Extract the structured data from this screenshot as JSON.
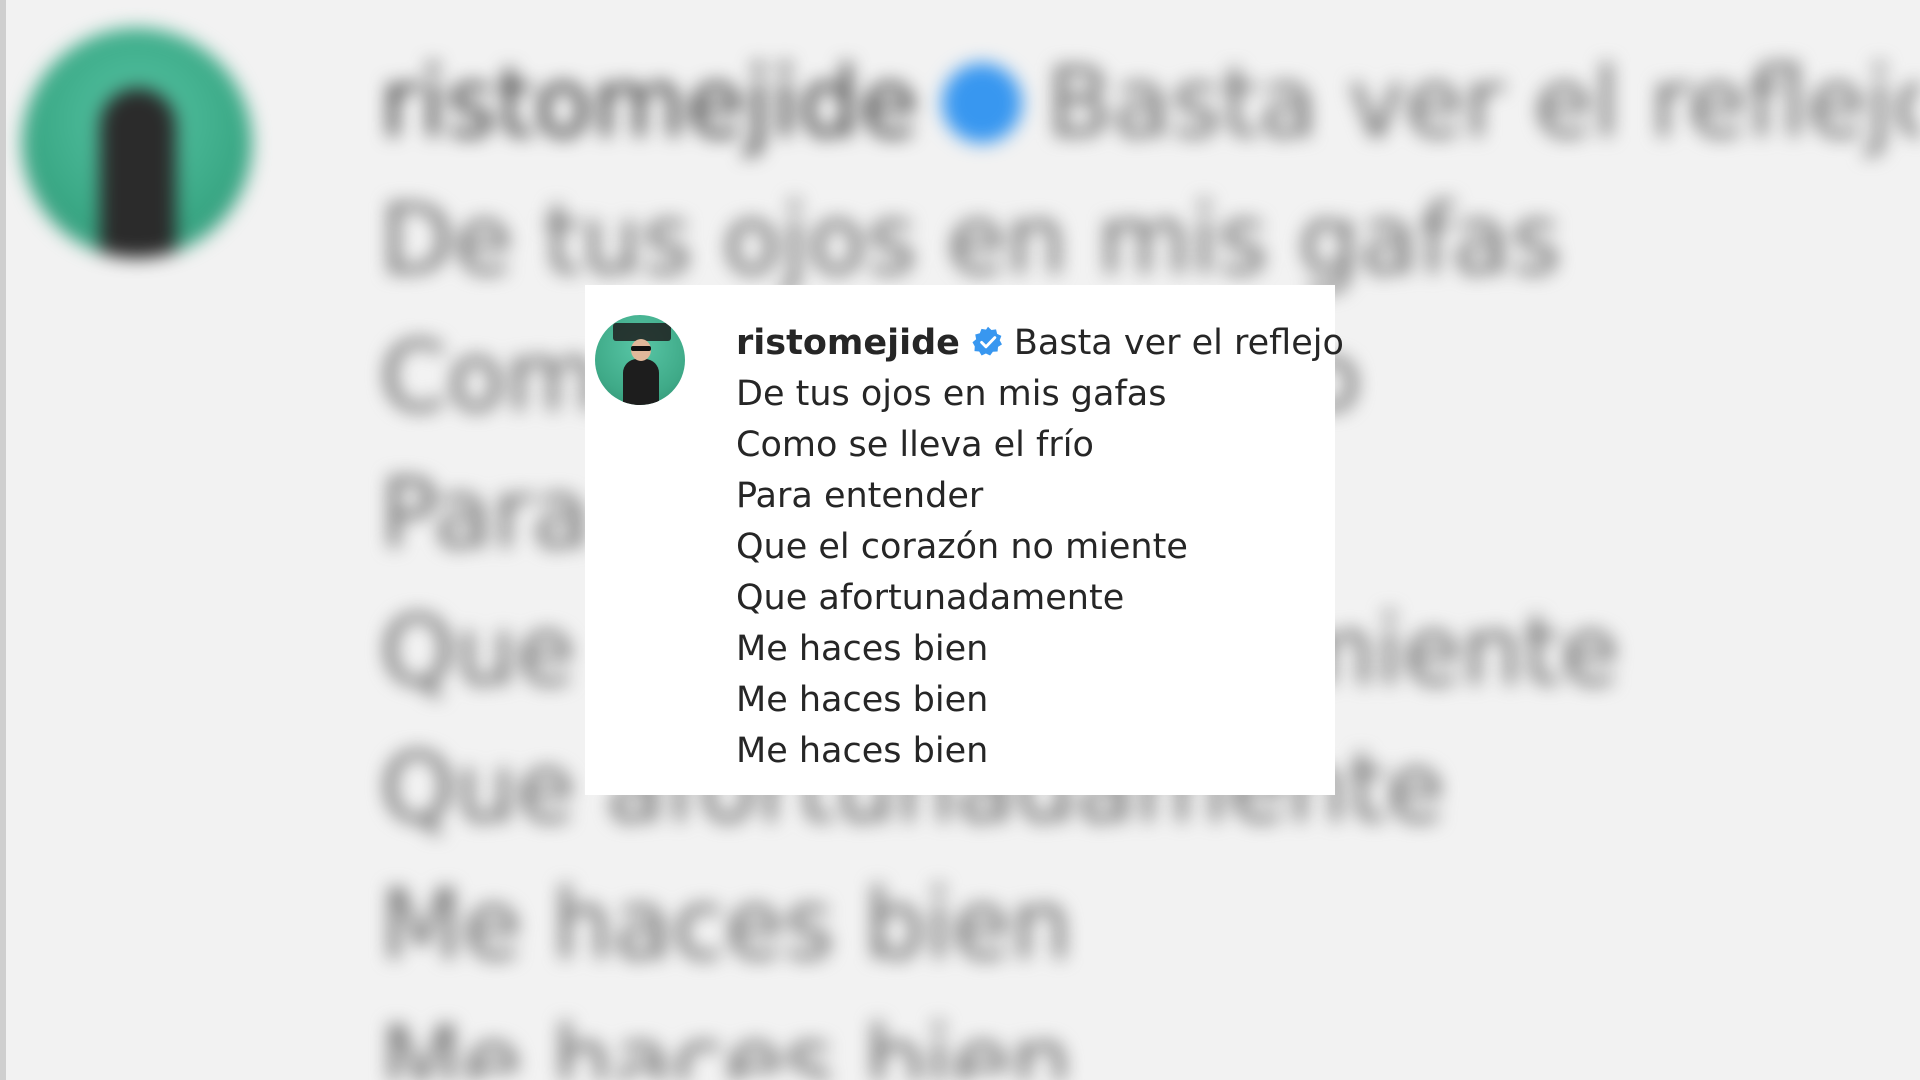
{
  "comment": {
    "username": "ristomejide",
    "verified": true,
    "lines": [
      "Basta ver el reflejo",
      "De tus ojos en mis gafas",
      "Como se lleva el frío",
      "Para entender",
      "Que el corazón no miente",
      "Que afortunadamente",
      "Me haces bien",
      "Me haces bien",
      "Me haces bien"
    ]
  },
  "colors": {
    "text": "#262626",
    "verified_badge": "#3897f0",
    "avatar_background": "#3faa88",
    "card_background": "#ffffff"
  },
  "icons": {
    "verified": "verified-badge-icon"
  }
}
